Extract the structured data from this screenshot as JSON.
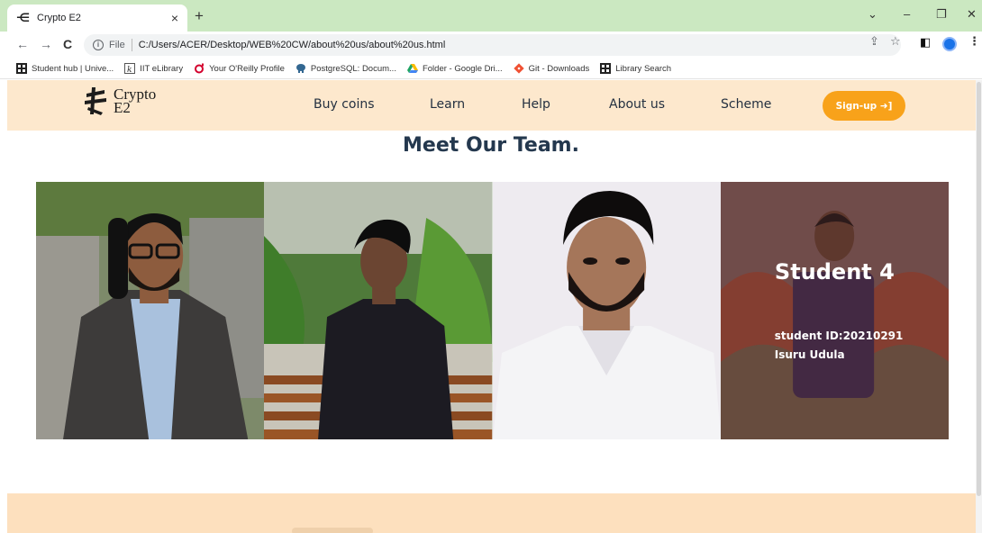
{
  "browser": {
    "tab_title": "Crypto E2",
    "tab_close": "×",
    "new_tab": "+",
    "window_controls": [
      "⌄",
      "–",
      "❐",
      "✕"
    ],
    "nav": {
      "back": "←",
      "forward": "→",
      "reload": "C"
    },
    "address": {
      "scheme_label": "File",
      "url": "C:/Users/ACER/Desktop/WEB%20CW/about%20us/about%20us.html"
    },
    "bookmarks": [
      {
        "label": "Student hub | Unive...",
        "icon": "grid-icon",
        "color": "#222222"
      },
      {
        "label": "IIT eLibrary",
        "icon": "k-icon",
        "color": "#555555"
      },
      {
        "label": "Your O'Reilly Profile",
        "icon": "oreilly-icon",
        "color": "#d3002d"
      },
      {
        "label": "PostgreSQL: Docum...",
        "icon": "elephant-icon",
        "color": "#336791"
      },
      {
        "label": "Folder - Google Dri...",
        "icon": "drive-icon",
        "color": "#1fa463"
      },
      {
        "label": "Git - Downloads",
        "icon": "git-icon",
        "color": "#f05133"
      },
      {
        "label": "Library Search",
        "icon": "grid-icon",
        "color": "#222222"
      }
    ]
  },
  "site": {
    "logo_line1": "Crypto",
    "logo_line2": "E2",
    "nav_links": [
      "Buy coins",
      "Learn",
      "Help",
      "About us",
      "Scheme"
    ],
    "signup_label": "Sign-up ➜]",
    "team_heading": "Meet Our Team.",
    "members": [
      {
        "overlay": false
      },
      {
        "overlay": false
      },
      {
        "overlay": false
      },
      {
        "overlay": true,
        "title": "Student 4",
        "student_id": "student ID:20210291",
        "name": "Isuru Udula"
      }
    ],
    "colors": {
      "nav_bg": "#fde8cd",
      "accent": "#f8a21a",
      "heading": "#24384e",
      "footer_bg": "#fde0be"
    }
  }
}
